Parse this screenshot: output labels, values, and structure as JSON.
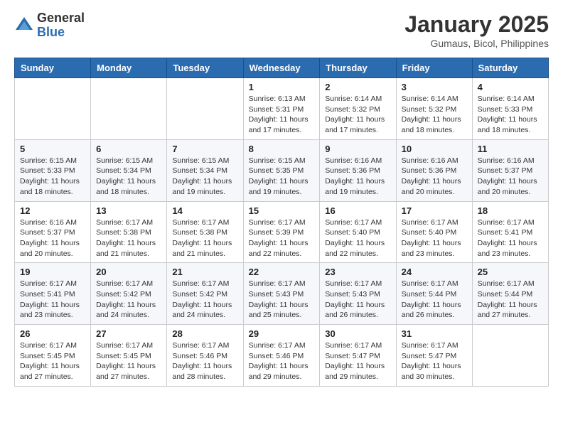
{
  "header": {
    "logo_general": "General",
    "logo_blue": "Blue",
    "month_title": "January 2025",
    "location": "Gumaus, Bicol, Philippines"
  },
  "weekdays": [
    "Sunday",
    "Monday",
    "Tuesday",
    "Wednesday",
    "Thursday",
    "Friday",
    "Saturday"
  ],
  "weeks": [
    [
      {
        "day": "",
        "sunrise": "",
        "sunset": "",
        "daylight": ""
      },
      {
        "day": "",
        "sunrise": "",
        "sunset": "",
        "daylight": ""
      },
      {
        "day": "",
        "sunrise": "",
        "sunset": "",
        "daylight": ""
      },
      {
        "day": "1",
        "sunrise": "Sunrise: 6:13 AM",
        "sunset": "Sunset: 5:31 PM",
        "daylight": "Daylight: 11 hours and 17 minutes."
      },
      {
        "day": "2",
        "sunrise": "Sunrise: 6:14 AM",
        "sunset": "Sunset: 5:32 PM",
        "daylight": "Daylight: 11 hours and 17 minutes."
      },
      {
        "day": "3",
        "sunrise": "Sunrise: 6:14 AM",
        "sunset": "Sunset: 5:32 PM",
        "daylight": "Daylight: 11 hours and 18 minutes."
      },
      {
        "day": "4",
        "sunrise": "Sunrise: 6:14 AM",
        "sunset": "Sunset: 5:33 PM",
        "daylight": "Daylight: 11 hours and 18 minutes."
      }
    ],
    [
      {
        "day": "5",
        "sunrise": "Sunrise: 6:15 AM",
        "sunset": "Sunset: 5:33 PM",
        "daylight": "Daylight: 11 hours and 18 minutes."
      },
      {
        "day": "6",
        "sunrise": "Sunrise: 6:15 AM",
        "sunset": "Sunset: 5:34 PM",
        "daylight": "Daylight: 11 hours and 18 minutes."
      },
      {
        "day": "7",
        "sunrise": "Sunrise: 6:15 AM",
        "sunset": "Sunset: 5:34 PM",
        "daylight": "Daylight: 11 hours and 19 minutes."
      },
      {
        "day": "8",
        "sunrise": "Sunrise: 6:15 AM",
        "sunset": "Sunset: 5:35 PM",
        "daylight": "Daylight: 11 hours and 19 minutes."
      },
      {
        "day": "9",
        "sunrise": "Sunrise: 6:16 AM",
        "sunset": "Sunset: 5:36 PM",
        "daylight": "Daylight: 11 hours and 19 minutes."
      },
      {
        "day": "10",
        "sunrise": "Sunrise: 6:16 AM",
        "sunset": "Sunset: 5:36 PM",
        "daylight": "Daylight: 11 hours and 20 minutes."
      },
      {
        "day": "11",
        "sunrise": "Sunrise: 6:16 AM",
        "sunset": "Sunset: 5:37 PM",
        "daylight": "Daylight: 11 hours and 20 minutes."
      }
    ],
    [
      {
        "day": "12",
        "sunrise": "Sunrise: 6:16 AM",
        "sunset": "Sunset: 5:37 PM",
        "daylight": "Daylight: 11 hours and 20 minutes."
      },
      {
        "day": "13",
        "sunrise": "Sunrise: 6:17 AM",
        "sunset": "Sunset: 5:38 PM",
        "daylight": "Daylight: 11 hours and 21 minutes."
      },
      {
        "day": "14",
        "sunrise": "Sunrise: 6:17 AM",
        "sunset": "Sunset: 5:38 PM",
        "daylight": "Daylight: 11 hours and 21 minutes."
      },
      {
        "day": "15",
        "sunrise": "Sunrise: 6:17 AM",
        "sunset": "Sunset: 5:39 PM",
        "daylight": "Daylight: 11 hours and 22 minutes."
      },
      {
        "day": "16",
        "sunrise": "Sunrise: 6:17 AM",
        "sunset": "Sunset: 5:40 PM",
        "daylight": "Daylight: 11 hours and 22 minutes."
      },
      {
        "day": "17",
        "sunrise": "Sunrise: 6:17 AM",
        "sunset": "Sunset: 5:40 PM",
        "daylight": "Daylight: 11 hours and 23 minutes."
      },
      {
        "day": "18",
        "sunrise": "Sunrise: 6:17 AM",
        "sunset": "Sunset: 5:41 PM",
        "daylight": "Daylight: 11 hours and 23 minutes."
      }
    ],
    [
      {
        "day": "19",
        "sunrise": "Sunrise: 6:17 AM",
        "sunset": "Sunset: 5:41 PM",
        "daylight": "Daylight: 11 hours and 23 minutes."
      },
      {
        "day": "20",
        "sunrise": "Sunrise: 6:17 AM",
        "sunset": "Sunset: 5:42 PM",
        "daylight": "Daylight: 11 hours and 24 minutes."
      },
      {
        "day": "21",
        "sunrise": "Sunrise: 6:17 AM",
        "sunset": "Sunset: 5:42 PM",
        "daylight": "Daylight: 11 hours and 24 minutes."
      },
      {
        "day": "22",
        "sunrise": "Sunrise: 6:17 AM",
        "sunset": "Sunset: 5:43 PM",
        "daylight": "Daylight: 11 hours and 25 minutes."
      },
      {
        "day": "23",
        "sunrise": "Sunrise: 6:17 AM",
        "sunset": "Sunset: 5:43 PM",
        "daylight": "Daylight: 11 hours and 26 minutes."
      },
      {
        "day": "24",
        "sunrise": "Sunrise: 6:17 AM",
        "sunset": "Sunset: 5:44 PM",
        "daylight": "Daylight: 11 hours and 26 minutes."
      },
      {
        "day": "25",
        "sunrise": "Sunrise: 6:17 AM",
        "sunset": "Sunset: 5:44 PM",
        "daylight": "Daylight: 11 hours and 27 minutes."
      }
    ],
    [
      {
        "day": "26",
        "sunrise": "Sunrise: 6:17 AM",
        "sunset": "Sunset: 5:45 PM",
        "daylight": "Daylight: 11 hours and 27 minutes."
      },
      {
        "day": "27",
        "sunrise": "Sunrise: 6:17 AM",
        "sunset": "Sunset: 5:45 PM",
        "daylight": "Daylight: 11 hours and 27 minutes."
      },
      {
        "day": "28",
        "sunrise": "Sunrise: 6:17 AM",
        "sunset": "Sunset: 5:46 PM",
        "daylight": "Daylight: 11 hours and 28 minutes."
      },
      {
        "day": "29",
        "sunrise": "Sunrise: 6:17 AM",
        "sunset": "Sunset: 5:46 PM",
        "daylight": "Daylight: 11 hours and 29 minutes."
      },
      {
        "day": "30",
        "sunrise": "Sunrise: 6:17 AM",
        "sunset": "Sunset: 5:47 PM",
        "daylight": "Daylight: 11 hours and 29 minutes."
      },
      {
        "day": "31",
        "sunrise": "Sunrise: 6:17 AM",
        "sunset": "Sunset: 5:47 PM",
        "daylight": "Daylight: 11 hours and 30 minutes."
      },
      {
        "day": "",
        "sunrise": "",
        "sunset": "",
        "daylight": ""
      }
    ]
  ]
}
